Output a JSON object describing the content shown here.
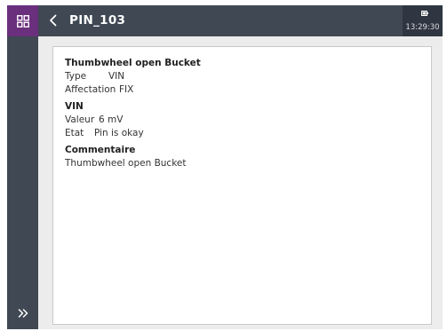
{
  "header": {
    "title": "PIN_103",
    "time": "13:29:30"
  },
  "icons": {
    "apps": "apps-grid-icon",
    "back": "chevron-left-icon",
    "battery": "battery-icon",
    "expand": "double-chevron-right-icon"
  },
  "colors": {
    "accent": "#6a2f7d",
    "header_bg": "#404854",
    "status_bg": "#2f3641"
  },
  "pin": {
    "name": "Thumbwheel open Bucket",
    "type_label": "Type",
    "type_value": "VIN",
    "affectation_label": "Affectation",
    "affectation_value": "FIX"
  },
  "measure": {
    "heading": "VIN",
    "valeur_label": "Valeur",
    "valeur_value": "6 mV",
    "etat_label": "Etat",
    "etat_value": "Pin is okay"
  },
  "comment": {
    "heading": "Commentaire",
    "text": "Thumbwheel open Bucket"
  }
}
